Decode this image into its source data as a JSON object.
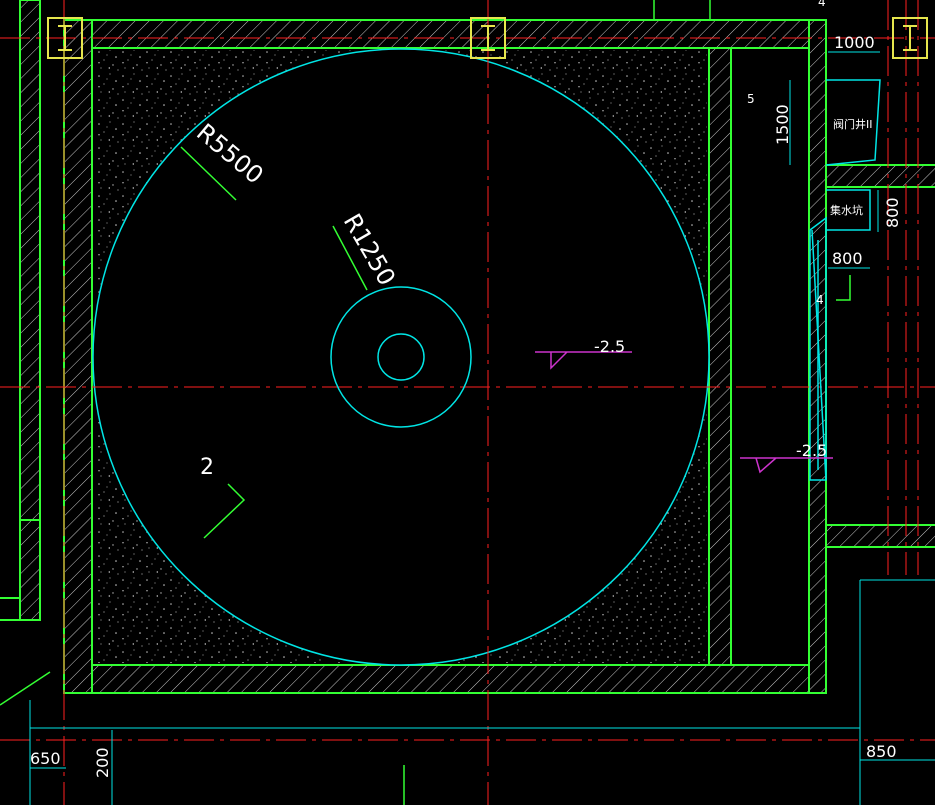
{
  "drawing": {
    "dimensions": {
      "outer_radius": "R5500",
      "inner_radius": "R1250",
      "right_top_width": "1000",
      "right_mid_height": "1500",
      "collector_height": "800",
      "collector_width": "800",
      "bottom_left": "650",
      "bottom_left_vertical": "200",
      "bottom_right": "850"
    },
    "levels": {
      "center": "-2.5",
      "right_channel": "-2.5"
    },
    "labels": {
      "item_2": "2",
      "item_4_top": "4",
      "item_4_right": "4",
      "item_5": "5",
      "valve_well": "阀门井II",
      "collector_pit": "集水坑"
    },
    "colors": {
      "background": "#000000",
      "wall_green": "#33ff33",
      "axis_red": "#ff2020",
      "outline_cyan": "#00e5e5",
      "level_magenta": "#cc33cc",
      "column_yellow": "#e6e64d",
      "text_white": "#ffffff"
    }
  }
}
